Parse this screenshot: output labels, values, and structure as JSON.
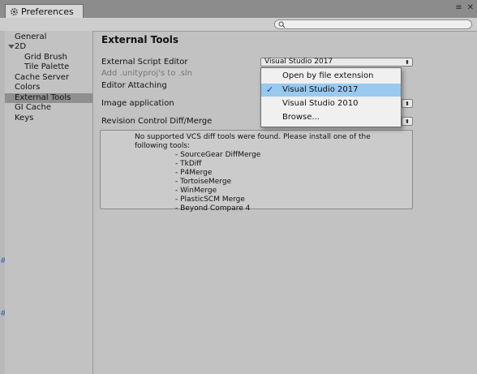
{
  "window": {
    "tab_title": "Preferences",
    "menu_icon": "menu-icon",
    "close_icon": "close-icon"
  },
  "search": {
    "placeholder": ""
  },
  "sidebar": {
    "items": [
      {
        "label": "General"
      },
      {
        "label": "2D"
      },
      {
        "label": "Grid Brush"
      },
      {
        "label": "Tile Palette"
      },
      {
        "label": "Cache Server"
      },
      {
        "label": "Colors"
      },
      {
        "label": "External Tools"
      },
      {
        "label": "GI Cache"
      },
      {
        "label": "Keys"
      }
    ]
  },
  "main": {
    "heading": "External Tools",
    "script_editor_label": "External Script Editor",
    "script_editor_value": "Visual Studio 2017",
    "add_unityproj_label": "Add .unityproj's to .sln",
    "editor_attaching_label": "Editor Attaching",
    "image_app_label": "Image application",
    "revision_label": "Revision Control Diff/Merge",
    "help_message": "No supported VCS diff tools were found. Please install one of the following tools:",
    "tools": [
      "- SourceGear DiffMerge",
      "- TkDiff",
      "- P4Merge",
      "- TortoiseMerge",
      "- WinMerge",
      "- PlasticSCM Merge",
      "- Beyond Compare 4"
    ]
  },
  "dropdown": {
    "items": [
      {
        "label": "Open by file extension",
        "checked": false
      },
      {
        "label": "Visual Studio 2017",
        "checked": true
      },
      {
        "label": "Visual Studio 2010",
        "checked": false
      },
      {
        "label": "Browse...",
        "checked": false
      }
    ]
  },
  "colors": {
    "selection": "#99c9ef",
    "sidebar_selected": "#8f8f8f",
    "background": "#c2c2c2"
  }
}
